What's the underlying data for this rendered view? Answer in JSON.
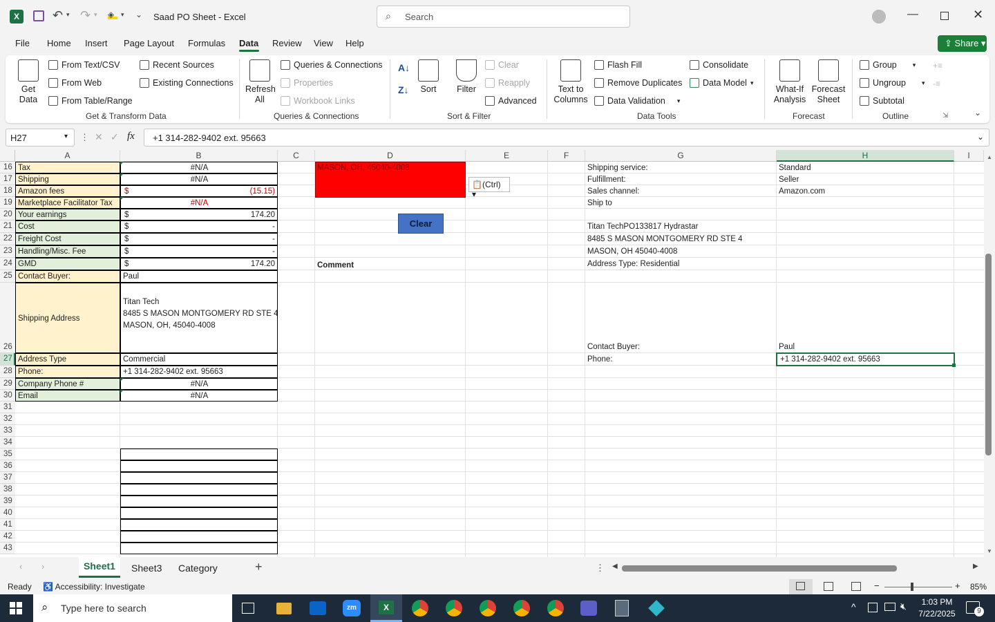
{
  "app": {
    "title": "Saad PO Sheet  -  Excel",
    "search_placeholder": "Search"
  },
  "menu": [
    "File",
    "Home",
    "Insert",
    "Page Layout",
    "Formulas",
    "Data",
    "Review",
    "View",
    "Help"
  ],
  "share_label": "Share",
  "ribbon": {
    "get_data": "Get\nData",
    "from_text": "From Text/CSV",
    "from_web": "From Web",
    "from_table": "From Table/Range",
    "recent_sources": "Recent Sources",
    "existing_connections": "Existing Connections",
    "group_get": "Get & Transform Data",
    "refresh_all": "Refresh\nAll",
    "queries": "Queries & Connections",
    "properties": "Properties",
    "workbook_links": "Workbook Links",
    "group_queries": "Queries & Connections",
    "sort": "Sort",
    "filter": "Filter",
    "clear": "Clear",
    "reapply": "Reapply",
    "advanced": "Advanced",
    "group_sort": "Sort & Filter",
    "text_to_columns": "Text to\nColumns",
    "flash_fill": "Flash Fill",
    "remove_duplicates": "Remove Duplicates",
    "data_validation": "Data Validation",
    "consolidate": "Consolidate",
    "data_model": "Data Model",
    "group_tools": "Data Tools",
    "what_if": "What-If\nAnalysis",
    "forecast_sheet": "Forecast\nSheet",
    "group_forecast": "Forecast",
    "group_btn": "Group",
    "ungroup": "Ungroup",
    "subtotal": "Subtotal",
    "group_outline": "Outline"
  },
  "formula_bar": {
    "name_box": "H27",
    "formula": "+1 314-282-9402 ext. 95663"
  },
  "columns": [
    "A",
    "B",
    "C",
    "D",
    "E",
    "F",
    "G",
    "H",
    "I"
  ],
  "rows": [
    "16",
    "17",
    "18",
    "19",
    "20",
    "21",
    "22",
    "23",
    "24",
    "25",
    "26",
    "27",
    "28",
    "29",
    "30",
    "31",
    "32",
    "33",
    "34",
    "35",
    "36",
    "37",
    "38",
    "39",
    "40",
    "41",
    "42",
    "43"
  ],
  "labels": {
    "tax": "Tax",
    "shipping": "Shipping",
    "amazon_fees": "Amazon fees",
    "mft": "Marketplace Facilitator Tax",
    "earnings": "Your earnings",
    "cost": "Cost",
    "freight": "Freight Cost",
    "handling": "Handling/Misc. Fee",
    "gmd": "GMD",
    "contact_buyer": "Contact Buyer:",
    "ship_addr": "Shipping Address",
    "addr_type": "Address Type",
    "phone": "Phone:",
    "company_phone": "Company Phone #",
    "email": "Email"
  },
  "values": {
    "tax": "#N/A",
    "shipping": "#N/A",
    "amazon_fees_sym": "$",
    "amazon_fees": "(15.15)",
    "mft": "#N/A",
    "earn_sym": "$",
    "earnings": "174.20",
    "cost_sym": "$",
    "cost": "-",
    "freight_sym": "$",
    "freight": "-",
    "handling_sym": "$",
    "handling": "-",
    "gmd_sym": "$",
    "gmd": "174.20",
    "contact_buyer": "Paul",
    "addr_line1": "Titan Tech",
    "addr_line2": "8485 S MASON MONTGOMERY RD STE 4",
    "addr_line3": "MASON, OH, 45040-4008",
    "addr_type": "Commercial",
    "phone": "+1 314-282-9402 ext. 95663",
    "company_phone": "#N/A",
    "email": "#N/A"
  },
  "col_d": {
    "red_text": "MASON, OH, 45040-4008",
    "clear_button": "Clear",
    "comment": "Comment",
    "paste_ctrl": "(Ctrl)"
  },
  "col_g": {
    "shipping_service": "Shipping service:",
    "fulfillment": "Fulfillment:",
    "sales_channel": "Sales channel:",
    "ship_to": "Ship to",
    "name_line": "Titan TechPO133817 Hydrastar",
    "addr_line": "8485 S MASON MONTGOMERY RD STE 4",
    "city_line": "MASON, OH 45040-4008",
    "addr_type": "Address Type:  Residential",
    "contact_buyer": "Contact Buyer:",
    "phone": "Phone:"
  },
  "col_h": {
    "shipping_service": "Standard",
    "fulfillment": "Seller",
    "sales_channel": "Amazon.com",
    "contact_buyer": "Paul",
    "phone": "+1 314-282-9402 ext. 95663"
  },
  "sheet_tabs": [
    "Sheet1",
    "Sheet3",
    "Category"
  ],
  "status": {
    "ready": "Ready",
    "accessibility": "Accessibility: Investigate",
    "zoom": "85%"
  },
  "taskbar": {
    "search_placeholder": "Type here to search",
    "time": "1:03 PM",
    "date": "7/22/2025",
    "notifications": "9"
  },
  "colors": {
    "excel_green": "#1e7145",
    "share_green": "#1a7f37",
    "label_yellow": "#fff2cc",
    "label_green": "#e2efda",
    "red_fill": "#ff0000",
    "clear_blue": "#4472c4",
    "neg_red": "#c00000"
  }
}
